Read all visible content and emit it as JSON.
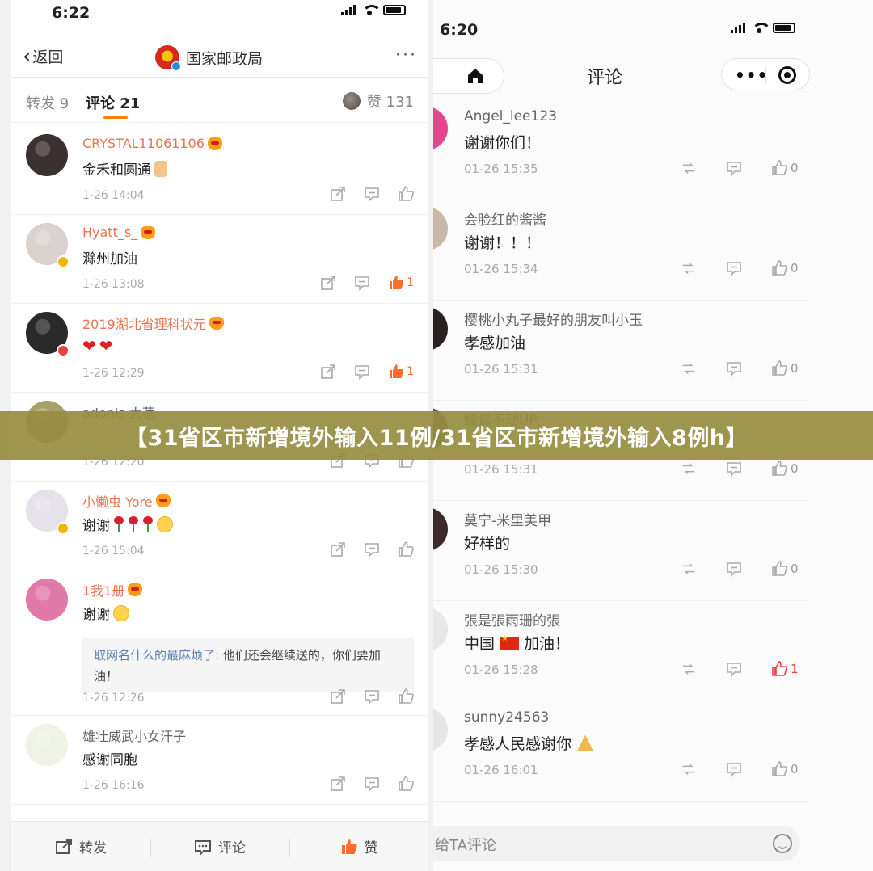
{
  "left": {
    "status": {
      "time": "6:22"
    },
    "nav": {
      "back": "返回",
      "title": "国家邮政局",
      "more": "···"
    },
    "tabs": {
      "repost": "转发 9",
      "comment": "评论 21",
      "likes": "赞 131"
    },
    "comments": [
      {
        "name": "CRYSTAL11061106",
        "text": "金禾和圆通",
        "time": "1-26 14:04",
        "likes": "",
        "avatar_color": "#3a3130"
      },
      {
        "name": "Hyatt_s_",
        "text": "滁州加油",
        "time": "1-26 13:08",
        "likes": "1",
        "avatar_color": "#d9d2cf"
      },
      {
        "name": "2019湖北省理科状元",
        "text": "",
        "time": "1-26 12:29",
        "likes": "1",
        "avatar_color": "#2a2a2a"
      },
      {
        "name": "adonis 大蓓",
        "text": "",
        "time": "1-26 12:20",
        "likes": "",
        "avatar_color": "#a9a068"
      },
      {
        "name": "小懒虫 Yore",
        "text": "谢谢",
        "time": "1-26 15:04",
        "likes": "",
        "avatar_color": "#e5e2ea"
      },
      {
        "name": "1我1册",
        "text": "谢谢",
        "time": "1-26 12:26",
        "likes": "",
        "avatar_color": "#e17aa8"
      },
      {
        "name": "雄壮威武小女汗子",
        "text": "感谢同胞",
        "time": "1-26 16:16",
        "likes": "",
        "avatar_color": "#eef3e6"
      }
    ],
    "reply": {
      "name": "取网名什么的最麻烦了:",
      "text": " 他们还会继续送的，你们要加油！"
    },
    "bottom": {
      "repost": "转发",
      "comment": "评论",
      "like": "赞"
    }
  },
  "right": {
    "status": {
      "time": "6:20"
    },
    "nav": {
      "title": "评论"
    },
    "comments": [
      {
        "name": "Angel_lee123",
        "text": "谢谢你们！",
        "time": "01-26 15:35",
        "likes": "0",
        "avatar_color": "#e5458f"
      },
      {
        "name": "会脸红的酱酱",
        "text": "谢谢！！！",
        "time": "01-26 15:34",
        "likes": "0",
        "avatar_color": "#c9b7a8"
      },
      {
        "name": "樱桃小丸子最好的朋友叫小玉",
        "text": "孝感加油",
        "time": "01-26 15:31",
        "likes": "0",
        "avatar_color": "#2a2020"
      },
      {
        "name": "蠕蠕不动UP",
        "text": "",
        "time": "01-26 15:31",
        "likes": "0",
        "avatar_color": "#6a5c56"
      },
      {
        "name": "莫宁-米里美甲",
        "text": "好样的",
        "time": "01-26 15:30",
        "likes": "0",
        "avatar_color": "#3a2a28"
      },
      {
        "name": "張是張雨珊的張",
        "text": "中国",
        "text_suffix": "加油！",
        "time": "01-26 15:28",
        "likes": "1",
        "avatar_color": "#e8e8e8"
      },
      {
        "name": "sunny24563",
        "text": "孝感人民感谢你",
        "time": "01-26 16:01",
        "likes": "0",
        "avatar_color": "#e6e6e6"
      }
    ],
    "input_placeholder": "给TA评论"
  },
  "banner": "【31省区市新增境外输入11例/31省区市新增境外输入8例h】",
  "colors": {
    "accent": "#ff8200",
    "like_active": "#ff6c2f",
    "banner_bg": "#968c40",
    "name_orange": "#eb7350"
  }
}
